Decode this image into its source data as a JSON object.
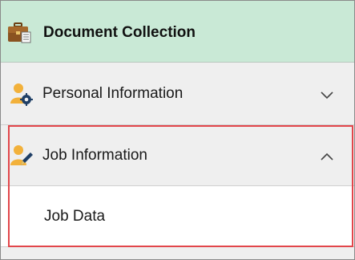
{
  "header": {
    "title": "Document Collection",
    "icon": "briefcase-document-icon",
    "background_color": "#c9e9d6"
  },
  "sections": [
    {
      "label": "Personal Information",
      "icon": "person-gear-icon",
      "expanded": false,
      "chevron": "chevron-down-icon"
    },
    {
      "label": "Job Information",
      "icon": "person-pencil-icon",
      "expanded": true,
      "chevron": "chevron-up-icon",
      "items": [
        {
          "label": "Job Data"
        }
      ]
    }
  ],
  "highlight_color": "#e2464b"
}
